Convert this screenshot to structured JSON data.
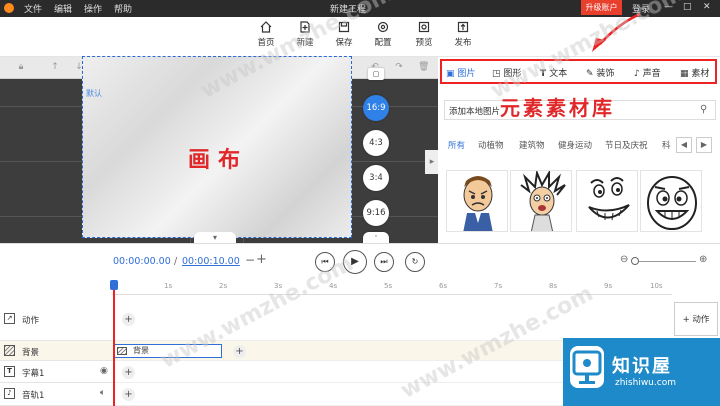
{
  "menu": {
    "file": "文件",
    "edit": "编辑",
    "operate": "操作",
    "help": "帮助"
  },
  "window_title": "新建工程",
  "account": {
    "upgrade": "升级账户",
    "login": "登录"
  },
  "toolbar": [
    {
      "label": "首页",
      "icon": "home-icon"
    },
    {
      "label": "新建",
      "icon": "new-icon"
    },
    {
      "label": "保存",
      "icon": "save-icon"
    },
    {
      "label": "配置",
      "icon": "settings-icon"
    },
    {
      "label": "预览",
      "icon": "preview-icon"
    },
    {
      "label": "发布",
      "icon": "publish-icon"
    }
  ],
  "canvas": {
    "tag": "默认",
    "annotation": "画布"
  },
  "ratios": [
    "16:9",
    "4:3",
    "3:4",
    "9:16"
  ],
  "active_ratio": "16:9",
  "panel": {
    "tabs": [
      "图片",
      "图形",
      "文本",
      "装饰",
      "声音",
      "素材"
    ],
    "active_tab": "图片",
    "add_local": "添加本地图片",
    "annotation": "元素素材库",
    "categories": [
      "所有",
      "动植物",
      "建筑物",
      "健身运动",
      "节日及庆祝",
      "科"
    ],
    "active_category": "所有"
  },
  "playback": {
    "current": "00:00:00.00",
    "separator": "/",
    "total": "00:00:10.00",
    "minus": "−",
    "plus": "+"
  },
  "ruler": [
    "1s",
    "2s",
    "3s",
    "4s",
    "5s",
    "6s",
    "7s",
    "8s",
    "9s",
    "10s"
  ],
  "tracks": [
    {
      "label": "动作",
      "icon": "action-icon"
    },
    {
      "label": "背景",
      "icon": "background-icon"
    },
    {
      "label": "字幕1",
      "icon": "subtitle-icon"
    },
    {
      "label": "音轨1",
      "icon": "audio-icon"
    }
  ],
  "background_clip": "背景",
  "add_action": "+ 动作",
  "watermark": {
    "brand": "知识屋",
    "url": "zhishiwu.com",
    "text": "www.wmzhe.com"
  },
  "colors": {
    "accent": "#2f6fd8",
    "highlight": "#e22222",
    "titlebar": "#2b2b2b",
    "upgrade": "#e8402c",
    "brand": "#1e8ac9"
  }
}
